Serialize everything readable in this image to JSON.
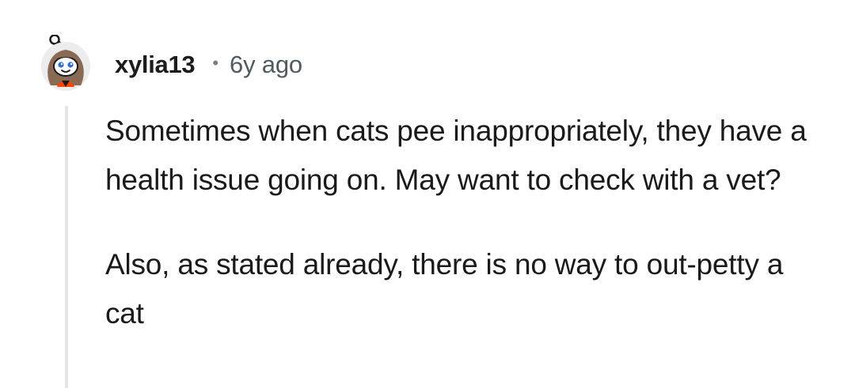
{
  "comment": {
    "author": "xylia13",
    "separator": "•",
    "time_ago": "6y ago",
    "avatar_icon": "snoo-avatar-icon",
    "paragraphs": [
      "Sometimes when cats pee inappropriately, they have a health issue going on. May want to check with a vet?",
      "Also, as stated already, there is no way to out-petty a cat"
    ]
  },
  "colors": {
    "text": "#1a1a1b",
    "meta": "#4f5a61",
    "thread_line": "#e6e6e6",
    "avatar_accent": "#ff4500"
  }
}
